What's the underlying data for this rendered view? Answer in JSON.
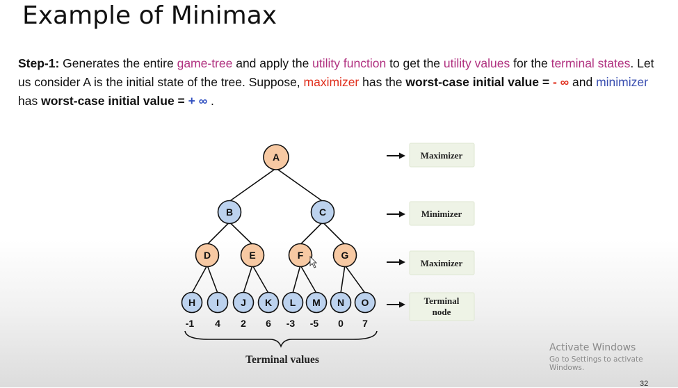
{
  "title": "Example of Minimax",
  "step": {
    "label": "Step-1:",
    "t1": " Generates the entire ",
    "game_tree": "game-tree",
    "t2": " and apply the ",
    "utility_function": "utility function",
    "t3": " to get the ",
    "utility_values": "utility values",
    "t4": " for the ",
    "terminal_states": "terminal states",
    "t5": ". Let us consider A is the initial state of the tree. Suppose, ",
    "maximizer": "maximizer",
    "t6": " has the ",
    "worst_case_1": "worst-case initial value = ",
    "minus_inf": "- ∞",
    "t7": " and ",
    "minimizer": "minimizer",
    "t8": " has ",
    "worst_case_2": "worst-case initial value = ",
    "plus_inf": "+ ∞",
    "t9": " ."
  },
  "tree": {
    "levels": [
      {
        "nodes": [
          "A"
        ],
        "role": "Maximizer",
        "fill": "#f7c9a3"
      },
      {
        "nodes": [
          "B",
          "C"
        ],
        "role": "Minimizer",
        "fill": "#bcd2ee"
      },
      {
        "nodes": [
          "D",
          "E",
          "F",
          "G"
        ],
        "role": "Maximizer",
        "fill": "#f7c9a3"
      },
      {
        "nodes": [
          "H",
          "I",
          "J",
          "K",
          "L",
          "M",
          "N",
          "O"
        ],
        "role": "Terminal node",
        "fill": "#bcd2ee"
      }
    ],
    "terminal_values": [
      "-1",
      "4",
      "2",
      "6",
      "-3",
      "-5",
      "0",
      "7"
    ],
    "brace_label": "Terminal values"
  },
  "colors": {
    "accent_pink": "#b0307f",
    "maximizer_red": "#e0301e",
    "minimizer_blue": "#3a4fb0",
    "max_node": "#f7c9a3",
    "min_node": "#bcd2ee",
    "role_box": "#eef3e6"
  },
  "watermark": {
    "line1": "Activate Windows",
    "line2": "Go to Settings to activate Windows."
  },
  "page_number": "32"
}
